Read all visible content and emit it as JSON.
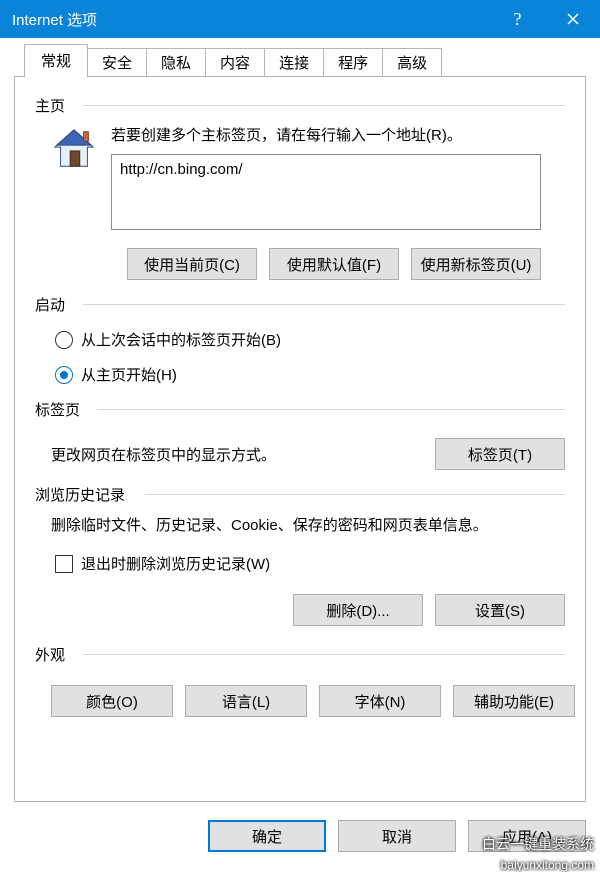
{
  "window": {
    "title": "Internet 选项"
  },
  "tabs": {
    "items": [
      "常规",
      "安全",
      "隐私",
      "内容",
      "连接",
      "程序",
      "高级"
    ],
    "active_index": 0
  },
  "homepage": {
    "group_label": "主页",
    "instruction": "若要创建多个主标签页，请在每行输入一个地址(R)。",
    "value": "http://cn.bing.com/",
    "btn_current": "使用当前页(C)",
    "btn_default": "使用默认值(F)",
    "btn_newtab": "使用新标签页(U)"
  },
  "startup": {
    "group_label": "启动",
    "opt_last_session": "从上次会话中的标签页开始(B)",
    "opt_home": "从主页开始(H)",
    "selected": "home"
  },
  "tabs_section": {
    "group_label": "标签页",
    "text": "更改网页在标签页中的显示方式。",
    "btn": "标签页(T)"
  },
  "history": {
    "group_label": "浏览历史记录",
    "text": "删除临时文件、历史记录、Cookie、保存的密码和网页表单信息。",
    "checkbox": "退出时删除浏览历史记录(W)",
    "checkbox_checked": false,
    "btn_delete": "删除(D)...",
    "btn_settings": "设置(S)"
  },
  "appearance": {
    "group_label": "外观",
    "btn_colors": "颜色(O)",
    "btn_lang": "语言(L)",
    "btn_font": "字体(N)",
    "btn_access": "辅助功能(E)"
  },
  "actions": {
    "ok": "确定",
    "cancel": "取消",
    "apply": "应用(A)"
  },
  "watermark": {
    "line1": "白云一键重装系统",
    "line2": "baiyunxitong.com"
  },
  "icons": {
    "help": "help-icon",
    "close": "close-icon",
    "home": "home-icon"
  }
}
